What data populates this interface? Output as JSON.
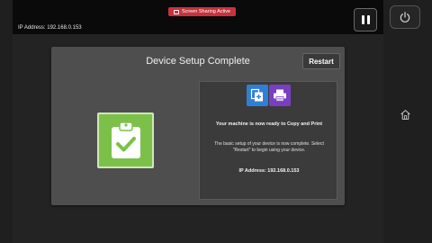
{
  "status_bar": {
    "ip_text": "IP Address: 192.168.0.153",
    "badge_text": "Screen Sharing Active"
  },
  "dialog": {
    "title": "Device Setup Complete",
    "restart_label": "Restart",
    "heading": "Your machine is now ready to Copy and Print",
    "body": "The basic setup of your device is now complete. Select \"Restart\" to begin using your device.",
    "ip_text": "IP Address: 192.168.0.153"
  },
  "icons": {
    "copy": "copy-icon",
    "print": "print-icon",
    "clipboard": "clipboard-check-icon",
    "power": "power-icon",
    "home": "home-icon",
    "pause": "pause-icon"
  },
  "colors": {
    "badge": "#c8323c",
    "clipboard_tile": "#7cc04a",
    "copy_app": "#2f7fd6",
    "print_app": "#7a3fc0"
  }
}
